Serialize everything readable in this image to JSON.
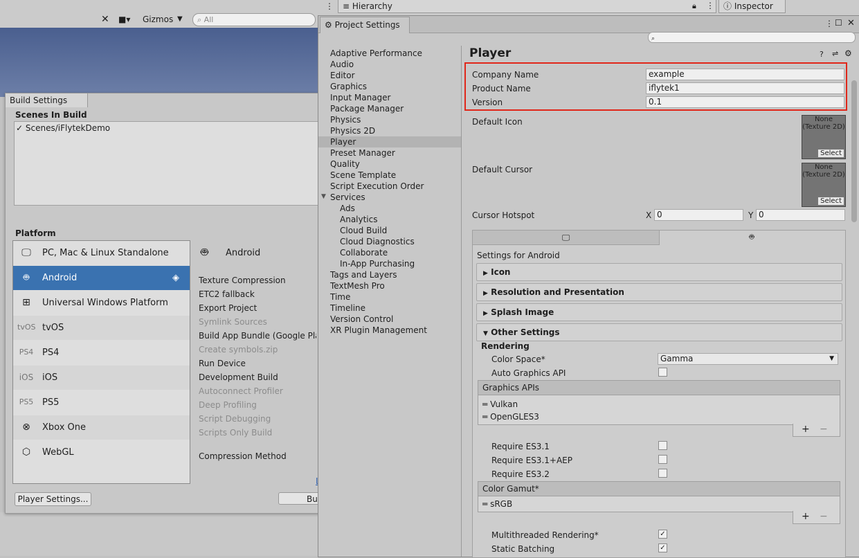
{
  "toolbar": {
    "gizmos_label": "Gizmos",
    "search_placeholder": "All",
    "hierarchy_tab": "Hierarchy",
    "inspector_tab": "Inspector"
  },
  "build_settings": {
    "title": "Build Settings",
    "scenes_in_build_label": "Scenes In Build",
    "scenes": [
      {
        "name": "Scenes/iFlytekDemo",
        "checked": "✓"
      }
    ],
    "platform_label": "Platform",
    "platforms": [
      {
        "label": "PC, Mac & Linux Standalone",
        "icon": "monitor-icon"
      },
      {
        "label": "Android",
        "icon": "android-icon",
        "selected": true
      },
      {
        "label": "Universal Windows Platform",
        "icon": "windows-icon"
      },
      {
        "label": "tvOS",
        "icon_text": "tvOS"
      },
      {
        "label": "PS4",
        "icon_text": "PS4"
      },
      {
        "label": "iOS",
        "icon_text": "iOS"
      },
      {
        "label": "PS5",
        "icon_text": "PS5"
      },
      {
        "label": "Xbox One",
        "icon": "xbox-icon"
      },
      {
        "label": "WebGL",
        "icon": "html5-icon"
      }
    ],
    "selected_platform_title": "Android",
    "options": [
      {
        "label": "Texture Compression",
        "enabled": true
      },
      {
        "label": "ETC2 fallback",
        "enabled": true
      },
      {
        "label": "Export Project",
        "enabled": true
      },
      {
        "label": "Symlink Sources",
        "enabled": false
      },
      {
        "label": "Build App Bundle (Google Play",
        "enabled": true
      },
      {
        "label": "Create symbols.zip",
        "enabled": false
      },
      {
        "label": "Run Device",
        "enabled": true
      },
      {
        "label": "Development Build",
        "enabled": true
      },
      {
        "label": "Autoconnect Profiler",
        "enabled": false
      },
      {
        "label": "Deep Profiling",
        "enabled": false
      },
      {
        "label": "Script Debugging",
        "enabled": false
      },
      {
        "label": "Scripts Only Build",
        "enabled": false
      },
      {
        "label": "Compression Method",
        "enabled": true
      }
    ],
    "link_fragment": "L",
    "player_settings_button": "Player Settings...",
    "build_button_fragment": "Bui"
  },
  "project_settings": {
    "title": "Project Settings",
    "sidebar": [
      {
        "label": "Adaptive Performance"
      },
      {
        "label": "Audio"
      },
      {
        "label": "Editor"
      },
      {
        "label": "Graphics"
      },
      {
        "label": "Input Manager"
      },
      {
        "label": "Package Manager"
      },
      {
        "label": "Physics"
      },
      {
        "label": "Physics 2D"
      },
      {
        "label": "Player",
        "selected": true
      },
      {
        "label": "Preset Manager"
      },
      {
        "label": "Quality"
      },
      {
        "label": "Scene Template"
      },
      {
        "label": "Script Execution Order"
      },
      {
        "label": "Services",
        "expanded": true
      },
      {
        "label": "Ads",
        "sub": true
      },
      {
        "label": "Analytics",
        "sub": true
      },
      {
        "label": "Cloud Build",
        "sub": true
      },
      {
        "label": "Cloud Diagnostics",
        "sub": true
      },
      {
        "label": "Collaborate",
        "sub": true
      },
      {
        "label": "In-App Purchasing",
        "sub": true
      },
      {
        "label": "Tags and Layers"
      },
      {
        "label": "TextMesh Pro"
      },
      {
        "label": "Time"
      },
      {
        "label": "Timeline"
      },
      {
        "label": "Version Control"
      },
      {
        "label": "XR Plugin Management"
      }
    ],
    "player": {
      "heading": "Player",
      "company_name_label": "Company Name",
      "company_name_value": "example",
      "product_name_label": "Product Name",
      "product_name_value": "iflytek1",
      "version_label": "Version",
      "version_value": "0.1",
      "default_icon_label": "Default Icon",
      "default_cursor_label": "Default Cursor",
      "texture_none": "None",
      "texture_type": "(Texture 2D)",
      "select_label": "Select",
      "cursor_hotspot_label": "Cursor Hotspot",
      "hotspot_x_label": "X",
      "hotspot_x_value": "0",
      "hotspot_y_label": "Y",
      "hotspot_y_value": "0",
      "settings_for": "Settings for Android",
      "sections": {
        "icon": "Icon",
        "resolution": "Resolution and Presentation",
        "splash": "Splash Image",
        "other": "Other Settings"
      },
      "rendering_label": "Rendering",
      "color_space_label": "Color Space*",
      "color_space_value": "Gamma",
      "auto_graphics_api_label": "Auto Graphics API",
      "graphics_apis_label": "Graphics APIs",
      "graphics_apis": [
        "Vulkan",
        "OpenGLES3"
      ],
      "require_es31_label": "Require ES3.1",
      "require_es31aep_label": "Require ES3.1+AEP",
      "require_es32_label": "Require ES3.2",
      "color_gamut_label": "Color Gamut*",
      "color_gamut_items": [
        "sRGB"
      ],
      "multithreaded_label": "Multithreaded Rendering*",
      "static_batching_label": "Static Batching",
      "check_mark": "✓",
      "plus": "+",
      "minus": "−"
    }
  },
  "colors": {
    "accent_selected": "#3a72b0",
    "highlight_box": "#e0271a"
  }
}
